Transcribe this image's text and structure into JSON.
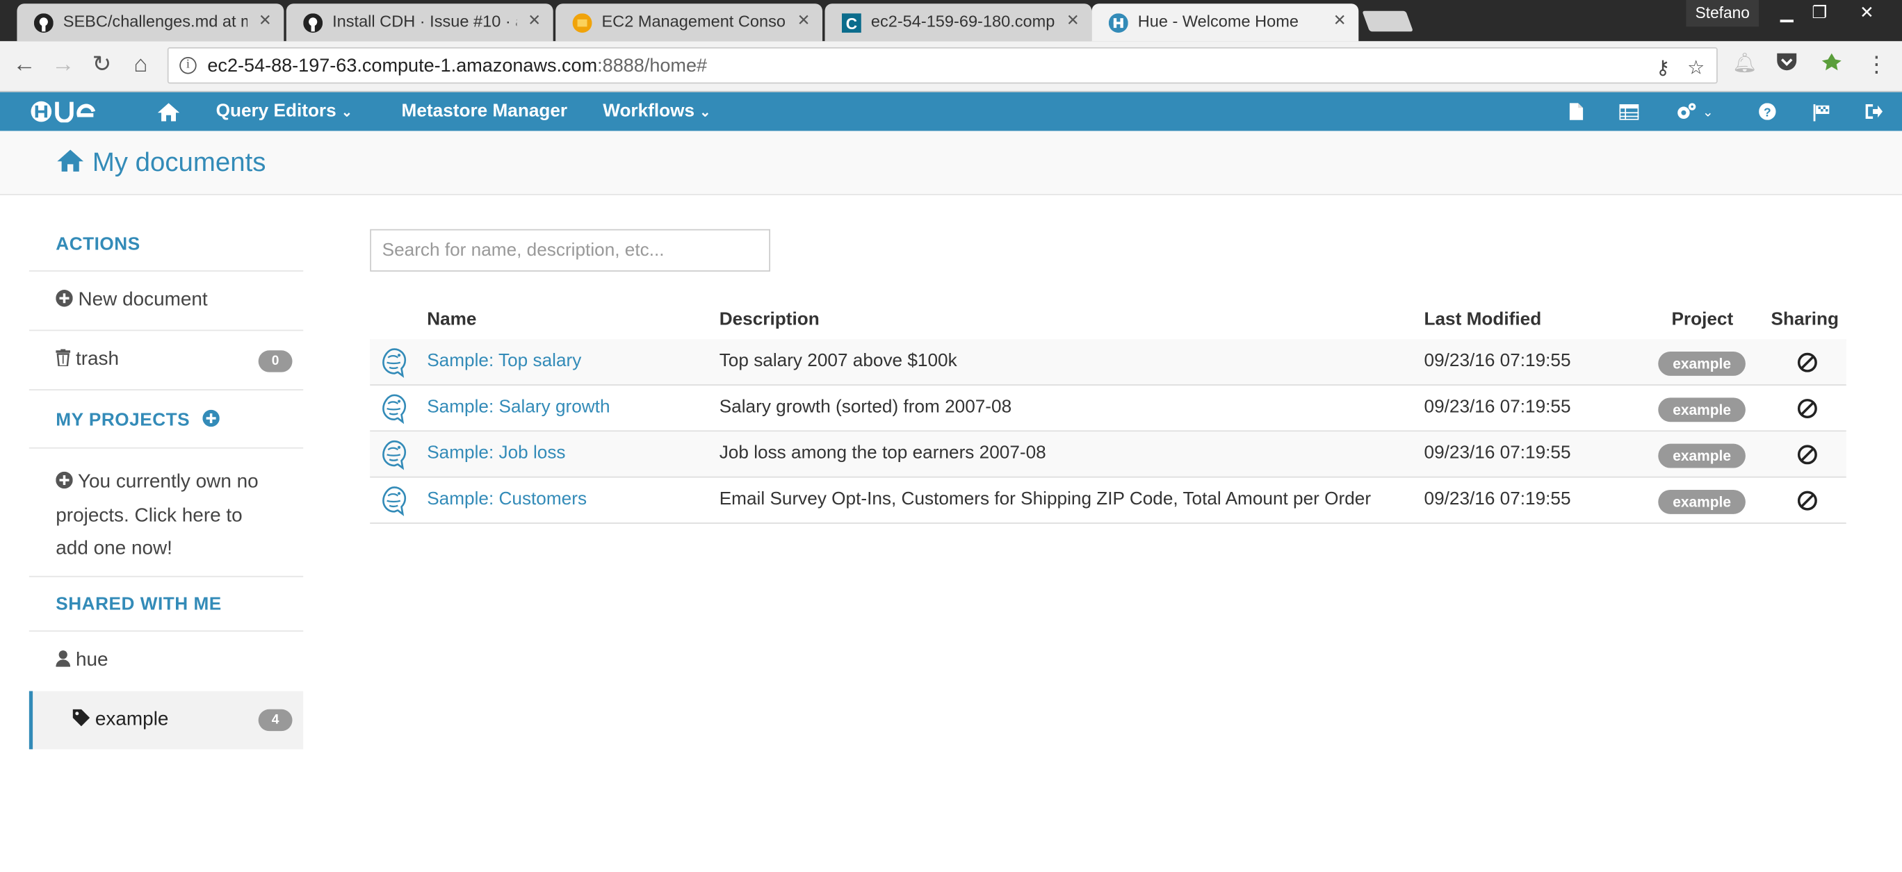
{
  "browser": {
    "tabs": [
      {
        "title": "SEBC/challenges.md at m",
        "icon": "github-icon"
      },
      {
        "title": "Install CDH · Issue #10 · a",
        "icon": "github-icon"
      },
      {
        "title": "EC2 Management Conso",
        "icon": "aws-icon"
      },
      {
        "title": "ec2-54-159-69-180.comp",
        "icon": "cloudera-icon"
      },
      {
        "title": "Hue - Welcome Home",
        "icon": "hue-icon",
        "active": true
      }
    ],
    "profile": "Stefano",
    "url_host": "ec2-54-88-197-63.compute-1.amazonaws.com",
    "url_rest": ":8888/home#"
  },
  "hue_nav": {
    "logo": "HUE",
    "items": [
      {
        "label": "Query Editors",
        "dropdown": true
      },
      {
        "label": "Metastore Manager",
        "dropdown": false
      },
      {
        "label": "Workflows",
        "dropdown": true
      }
    ]
  },
  "page": {
    "title": "My documents"
  },
  "sidebar": {
    "actions_heading": "ACTIONS",
    "new_document": "New document",
    "trash_label": "trash",
    "trash_count": "0",
    "projects_heading": "MY PROJECTS",
    "no_projects_line1": "You currently own no",
    "no_projects_line2": "projects. Click here to",
    "no_projects_line3": "add one now!",
    "shared_heading": "SHARED WITH ME",
    "shared_user": "hue",
    "tag_label": "example",
    "tag_count": "4"
  },
  "search": {
    "placeholder": "Search for name, description, etc..."
  },
  "table": {
    "headers": {
      "name": "Name",
      "description": "Description",
      "modified": "Last Modified",
      "project": "Project",
      "sharing": "Sharing"
    },
    "rows": [
      {
        "name": "Sample: Top salary",
        "description": "Top salary 2007 above $100k",
        "modified": "09/23/16 07:19:55",
        "project": "example"
      },
      {
        "name": "Sample: Salary growth",
        "description": "Salary growth (sorted) from 2007-08",
        "modified": "09/23/16 07:19:55",
        "project": "example"
      },
      {
        "name": "Sample: Job loss",
        "description": "Job loss among the top earners 2007-08",
        "modified": "09/23/16 07:19:55",
        "project": "example"
      },
      {
        "name": "Sample: Customers",
        "description": "Email Survey Opt-Ins, Customers for Shipping ZIP Code, Total Amount per Order",
        "modified": "09/23/16 07:19:55",
        "project": "example"
      }
    ]
  },
  "colors": {
    "hue_blue": "#338bb8",
    "badge_gray": "#999999"
  }
}
